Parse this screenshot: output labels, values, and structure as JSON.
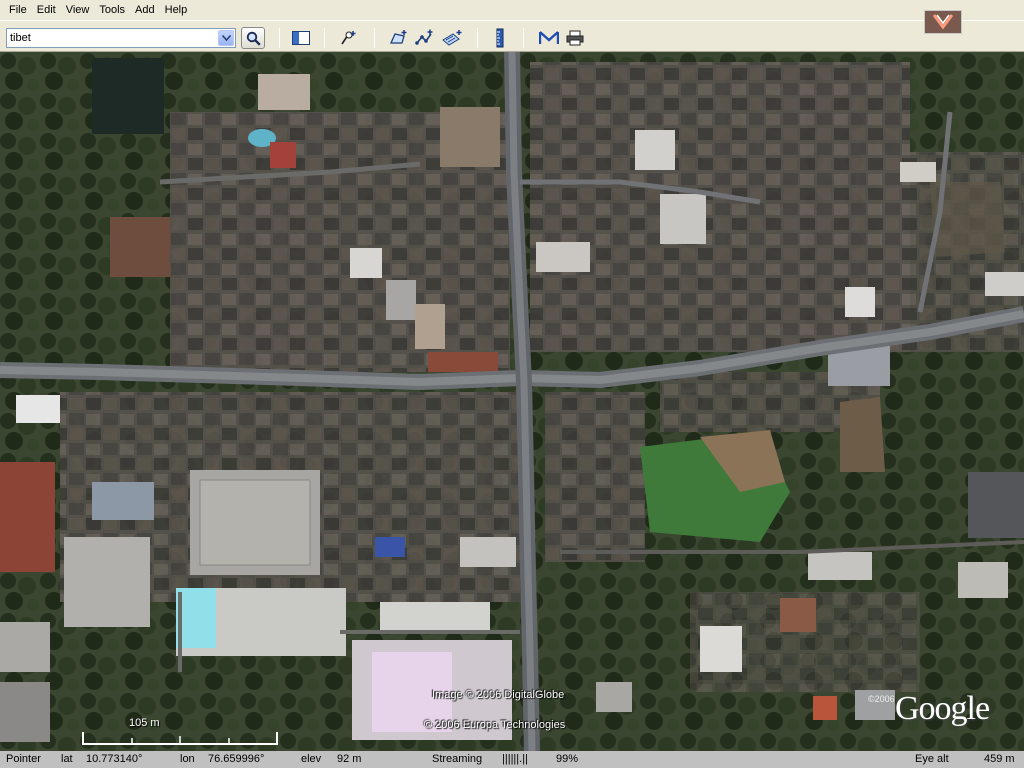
{
  "menu": {
    "file": "File",
    "edit": "Edit",
    "view": "View",
    "tools": "Tools",
    "add": "Add",
    "help": "Help"
  },
  "search": {
    "value": "tibet",
    "icon": "magnifier-icon"
  },
  "toolbar": {
    "icons": [
      "sidebar-toggle-icon",
      "placemark-icon",
      "polygon-icon",
      "path-icon",
      "image-overlay-icon",
      "ruler-icon",
      "email-icon",
      "print-icon",
      "compass-icon"
    ]
  },
  "map": {
    "attribution_image": "Image © 2006 DigitalGlobe",
    "attribution_terrain": "© 2006 Europa Technologies",
    "logo_year": "©2006",
    "logo_text": "Google",
    "scale_label": "105 m"
  },
  "status": {
    "pointer_label": "Pointer",
    "lat_label": "lat",
    "lat_value": "10.773140°",
    "lon_label": "lon",
    "lon_value": "76.659996°",
    "elev_label": "elev",
    "elev_value": "92 m",
    "streaming_label": "Streaming",
    "streaming_bar": "||||||.||",
    "streaming_percent": "99%",
    "eye_alt_label": "Eye alt",
    "eye_alt_value": "459 m"
  },
  "colors": {
    "chrome_bg": "#ece9d8",
    "status_bg": "#c0c0c0",
    "road": "#707478",
    "vegetation": "#2f3d26"
  }
}
